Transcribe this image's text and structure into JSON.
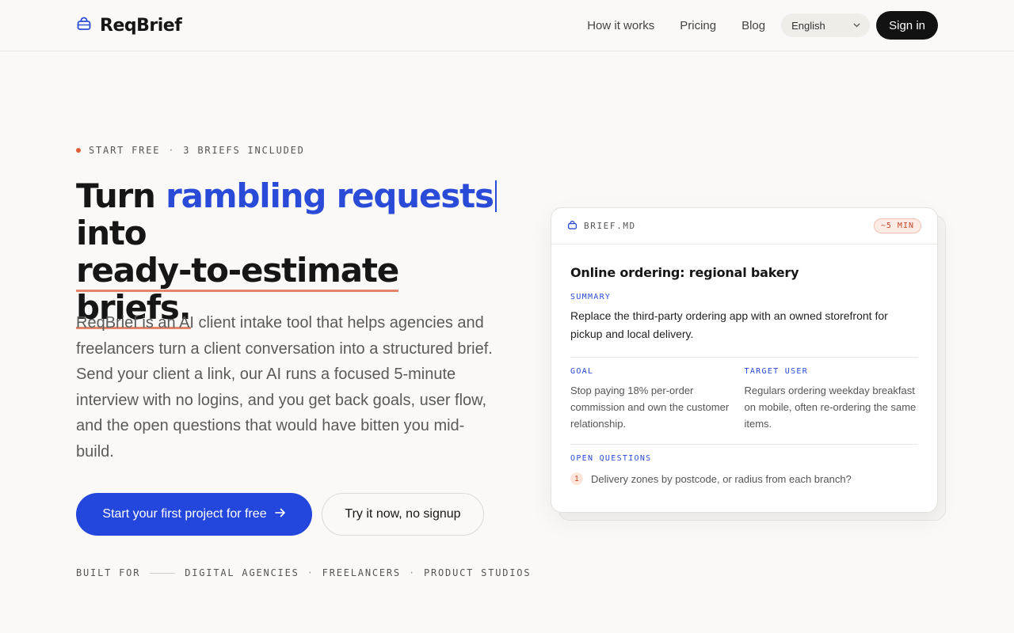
{
  "header": {
    "brand": "ReqBrief",
    "nav": [
      "How it works",
      "Pricing",
      "Blog"
    ],
    "language": "English",
    "signin_label": "Sign in"
  },
  "hero": {
    "eyebrow": [
      "START FREE",
      "3 BRIEFS INCLUDED"
    ],
    "headline": {
      "part1": "Turn ",
      "accent": "rambling requests",
      "part2": " into",
      "underline": "ready-to-estimate briefs."
    },
    "description": "ReqBrief is an AI client intake tool that helps agencies and freelancers turn a client conversation into a structured brief. Send your client a link, our AI runs a focused 5-minute interview with no logins, and you get back goals, user flow, and the open questions that would have bitten you mid-build.",
    "primary_cta": "Start your first project for free",
    "secondary_cta": "Try it now, no signup",
    "built_for_label": "BUILT FOR",
    "built_for": [
      "DIGITAL AGENCIES",
      "FREELANCERS",
      "PRODUCT STUDIOS"
    ]
  },
  "card": {
    "filename": "BRIEF.MD",
    "badge": "~5 MIN",
    "title": "Online ordering: regional bakery",
    "summary_label": "SUMMARY",
    "summary": "Replace the third-party ordering app with an owned storefront for pickup and local delivery.",
    "goal_label": "GOAL",
    "goal": "Stop paying 18% per-order commission and own the customer relationship.",
    "target_label": "TARGET USER",
    "target": "Regulars ordering weekday breakfast on mobile, often re-ordering the same items.",
    "open_questions_label": "OPEN QUESTIONS",
    "open_questions": [
      {
        "num": "1",
        "text": "Delivery zones by postcode, or radius from each branch?"
      }
    ]
  },
  "colors": {
    "accent": "#2a4bd7",
    "primary_button": "#2347dd",
    "highlight": "#e25c36",
    "background": "#faf9f7"
  }
}
